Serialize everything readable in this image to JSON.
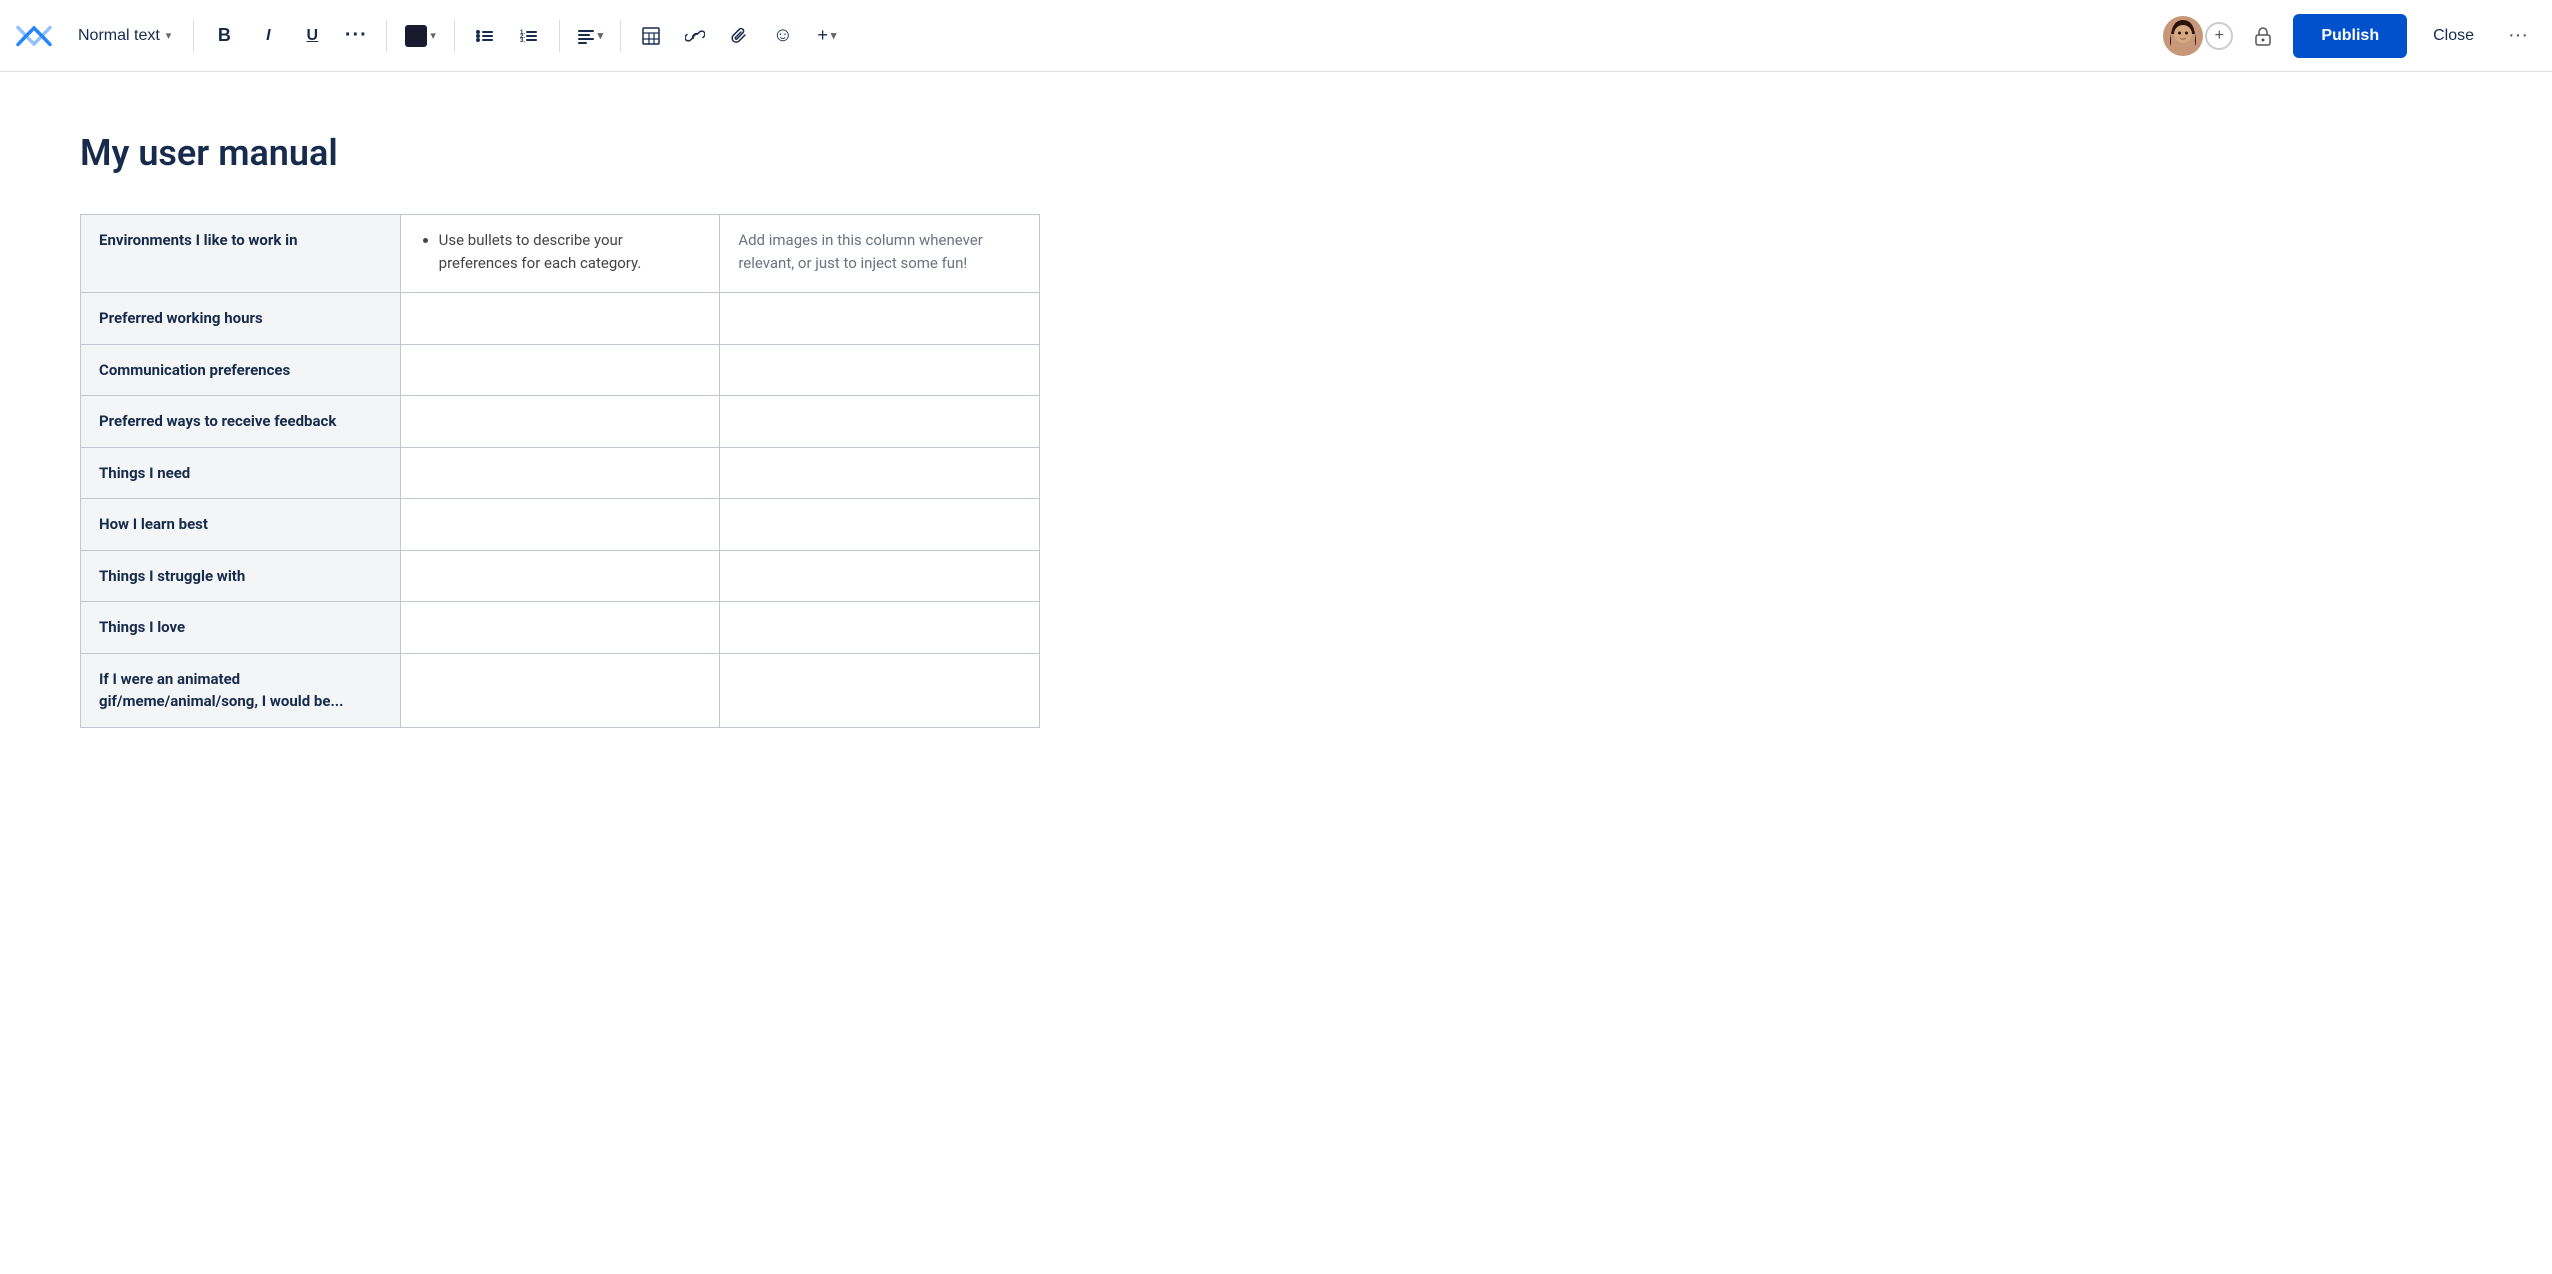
{
  "toolbar": {
    "logo_label": "Confluence logo",
    "text_style": "Normal text",
    "bold_label": "B",
    "italic_label": "I",
    "underline_label": "U",
    "more_formatting_label": "...",
    "color_label": "Text color",
    "bullet_list_label": "•≡",
    "numbered_list_label": "1≡",
    "align_label": "≡",
    "table_label": "⊞",
    "link_label": "🔗",
    "attachment_label": "📎",
    "emoji_label": "☺",
    "insert_label": "+",
    "add_collaborator_label": "+",
    "lock_label": "🔒",
    "publish_label": "Publish",
    "close_label": "Close",
    "more_options_label": "⋯"
  },
  "page": {
    "title": "My user manual"
  },
  "table": {
    "rows": [
      {
        "label": "Environments I like to work in",
        "bullets": "Use bullets to describe your preferences for each category.",
        "images_hint": "Add images in this column whenever relevant, or just to inject some fun!"
      },
      {
        "label": "Preferred working hours",
        "bullets": "",
        "images_hint": ""
      },
      {
        "label": "Communication preferences",
        "bullets": "",
        "images_hint": ""
      },
      {
        "label": "Preferred ways to receive feedback",
        "bullets": "",
        "images_hint": ""
      },
      {
        "label": "Things I need",
        "bullets": "",
        "images_hint": ""
      },
      {
        "label": "How I learn best",
        "bullets": "",
        "images_hint": ""
      },
      {
        "label": "Things I struggle with",
        "bullets": "",
        "images_hint": ""
      },
      {
        "label": "Things I love",
        "bullets": "",
        "images_hint": ""
      },
      {
        "label": "If I were an animated gif/meme/animal/song, I would be...",
        "bullets": "",
        "images_hint": ""
      }
    ]
  }
}
